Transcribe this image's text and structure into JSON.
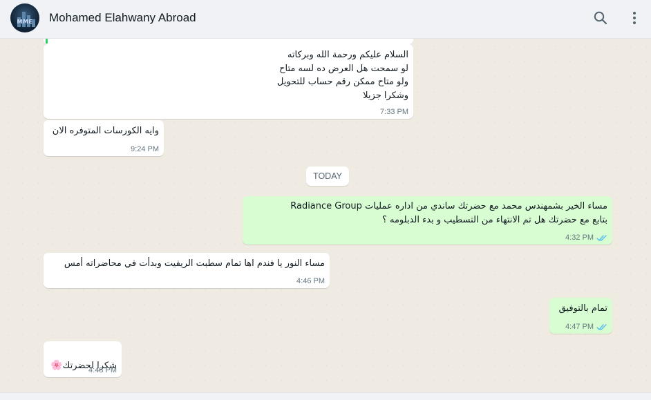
{
  "header": {
    "contact_name": "Mohamed Elahwany Abroad",
    "avatar_text": "MME",
    "search_icon": "search-icon",
    "menu_icon": "more-vertical-icon"
  },
  "date_separator": "TODAY",
  "messages": [
    {
      "direction": "incoming",
      "text": "السلام عليكم ورحمة الله وبركاته\nلو سمحت هل العرض ده لسه متاح\nولو متاح ممكن رقم حساب للتحويل\nوشكرا جزيلا",
      "time": "7:33 PM"
    },
    {
      "direction": "incoming",
      "text": "وايه الكورسات المتوفره الان",
      "time": "9:24 PM"
    },
    {
      "direction": "outgoing",
      "text": "مساء الخير بشمهندس محمد مع حضرتك ساندي من اداره عمليات Radiance Group\nبتابع مع حضرتك هل تم الانتهاء من التسطيب و بدء الدبلومه ؟",
      "time": "4:32 PM",
      "status": "read"
    },
    {
      "direction": "incoming",
      "text": "مساء النور يا فندم اها تمام سطبت الريفيت وبدأت في محاضراته أمس",
      "time": "4:46 PM"
    },
    {
      "direction": "outgoing",
      "text": "تمام بالتوفيق",
      "time": "4:47 PM",
      "status": "read"
    },
    {
      "direction": "incoming",
      "text": "شكرا لحضرتك",
      "emoji": "🌸",
      "time": "4:48 PM"
    }
  ],
  "colors": {
    "chat_bg": "#efeae2",
    "incoming_bubble": "#ffffff",
    "outgoing_bubble": "#d9fdd3",
    "read_ticks": "#53bdeb",
    "header_bg": "#f0f2f5"
  }
}
